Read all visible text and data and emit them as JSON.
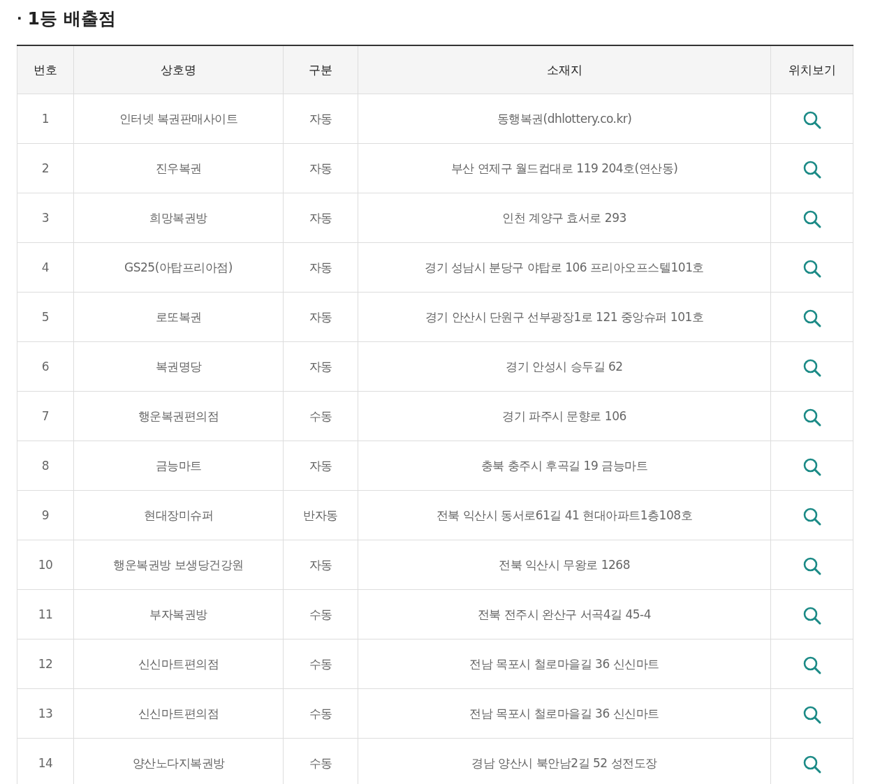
{
  "section": {
    "bullet": "·",
    "title": "1등 배출점"
  },
  "table": {
    "columns": [
      "번호",
      "상호명",
      "구분",
      "소재지",
      "위치보기"
    ],
    "rows": [
      {
        "no": "1",
        "name": "인터넷 복권판매사이트",
        "type": "자동",
        "address": "동행복권(dhlottery.co.kr)"
      },
      {
        "no": "2",
        "name": "진우복권",
        "type": "자동",
        "address": "부산 연제구 월드컵대로 119 204호(연산동)"
      },
      {
        "no": "3",
        "name": "희망복권방",
        "type": "자동",
        "address": "인천 계양구 효서로 293"
      },
      {
        "no": "4",
        "name": "GS25(아탑프리아점)",
        "type": "자동",
        "address": "경기 성남시 분당구 야탑로 106 프리아오프스텔101호"
      },
      {
        "no": "5",
        "name": "로또복권",
        "type": "자동",
        "address": "경기 안산시 단원구 선부광장1로 121 중앙슈퍼 101호"
      },
      {
        "no": "6",
        "name": "복권명당",
        "type": "자동",
        "address": "경기 안성시 승두길 62"
      },
      {
        "no": "7",
        "name": "행운복권편의점",
        "type": "수동",
        "address": "경기 파주시 문향로 106"
      },
      {
        "no": "8",
        "name": "금능마트",
        "type": "자동",
        "address": "충북 충주시 후곡길 19 금능마트"
      },
      {
        "no": "9",
        "name": "현대장미슈퍼",
        "type": "반자동",
        "address": "전북 익산시 동서로61길 41 현대아파트1층108호"
      },
      {
        "no": "10",
        "name": "행운복권방 보생당건강원",
        "type": "자동",
        "address": "전북 익산시 무왕로 1268"
      },
      {
        "no": "11",
        "name": "부자복권방",
        "type": "수동",
        "address": "전북 전주시 완산구 서곡4길 45-4"
      },
      {
        "no": "12",
        "name": "신신마트편의점",
        "type": "수동",
        "address": "전남 목포시 철로마을길 36 신신마트"
      },
      {
        "no": "13",
        "name": "신신마트편의점",
        "type": "수동",
        "address": "전남 목포시 철로마을길 36 신신마트"
      },
      {
        "no": "14",
        "name": "양산노다지복권방",
        "type": "수동",
        "address": "경남 양산시 북안남2길 52 성전도장"
      }
    ]
  }
}
